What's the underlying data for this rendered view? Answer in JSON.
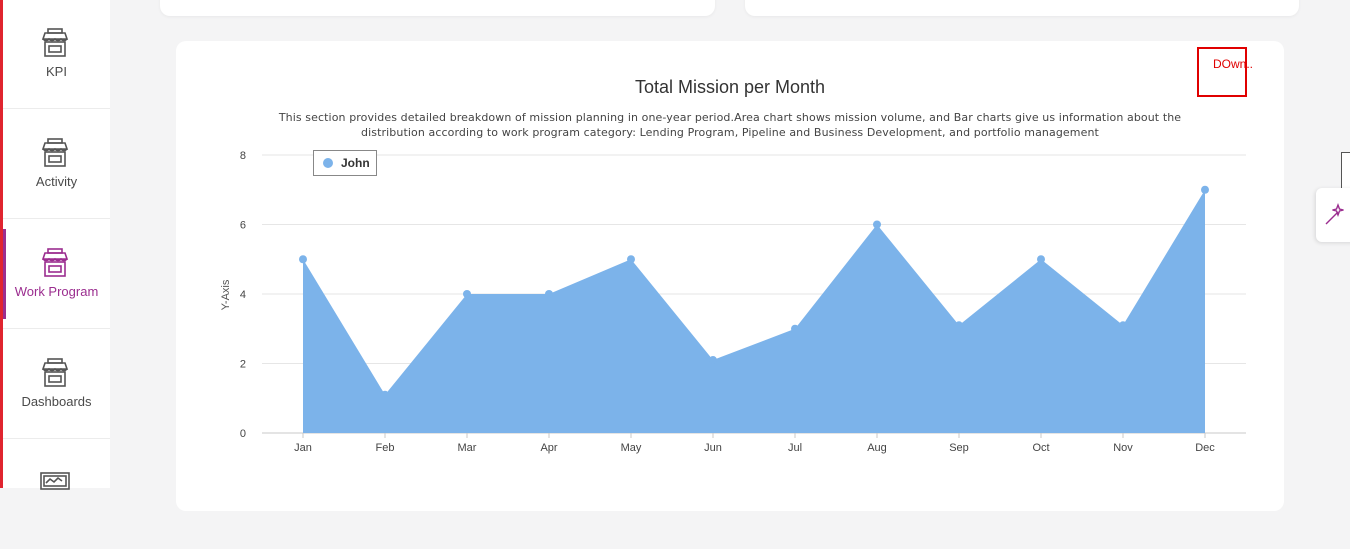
{
  "sidebar": {
    "items": [
      {
        "label": "KPI",
        "icon": "store-icon",
        "active": false
      },
      {
        "label": "Activity",
        "icon": "store-icon",
        "active": false
      },
      {
        "label": "Work Program",
        "icon": "store-icon",
        "active": true
      },
      {
        "label": "Dashboards",
        "icon": "store-icon",
        "active": false
      },
      {
        "label": "",
        "icon": "monitor-chart-icon",
        "active": false
      }
    ],
    "accent_color": "#9b2d8f",
    "border_color": "#e0242f"
  },
  "main": {
    "title": "Total Mission per Month",
    "description": "This section provides detailed breakdown of mission planning in one-year period.Area chart shows mission volume, and Bar charts give us information about the distribution according to work program category: Lending Program, Pipeline and Business Development, and portfolio management",
    "download_label": "DOwn.."
  },
  "chart_data": {
    "type": "area",
    "categories": [
      "Jan",
      "Feb",
      "Mar",
      "Apr",
      "May",
      "Jun",
      "Jul",
      "Aug",
      "Sep",
      "Oct",
      "Nov",
      "Dec"
    ],
    "series": [
      {
        "name": "John",
        "values": [
          5,
          1.1,
          4,
          4,
          5,
          2.1,
          3,
          6,
          3.1,
          5,
          3.1,
          7
        ],
        "color": "#7cb3ea"
      }
    ],
    "title": "Total Mission per Month",
    "xlabel": "",
    "ylabel": "Y-Axis",
    "ylim": [
      0,
      8
    ],
    "yticks": [
      0,
      2,
      4,
      6,
      8
    ],
    "grid": true,
    "legend_position": "top-left"
  }
}
